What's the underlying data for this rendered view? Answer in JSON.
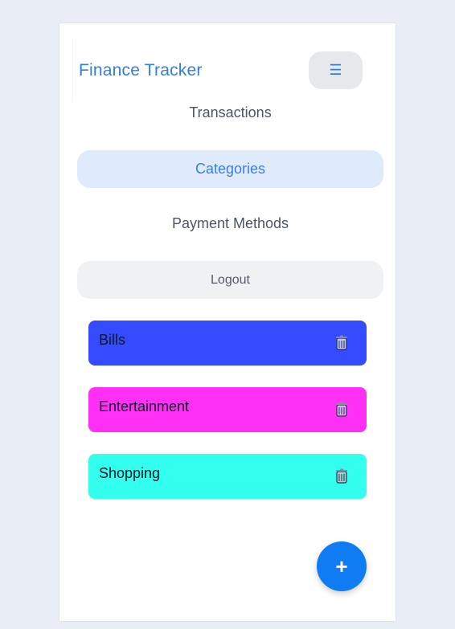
{
  "app": {
    "title": "Finance Tracker",
    "menu_icon": "hamburger-menu-icon"
  },
  "nav": {
    "items": [
      {
        "label": "Transactions",
        "active": false
      },
      {
        "label": "Categories",
        "active": true
      },
      {
        "label": "Payment Methods",
        "active": false
      },
      {
        "label": "Logout",
        "active": false
      }
    ]
  },
  "categories": [
    {
      "name": "Bills",
      "color": "#354bff",
      "icon": "trash-icon"
    },
    {
      "name": "Entertainment",
      "color": "#ff2ff5",
      "icon": "trash-icon"
    },
    {
      "name": "Shopping",
      "color": "#33ffee",
      "icon": "trash-icon"
    }
  ],
  "fab": {
    "label": "+"
  }
}
